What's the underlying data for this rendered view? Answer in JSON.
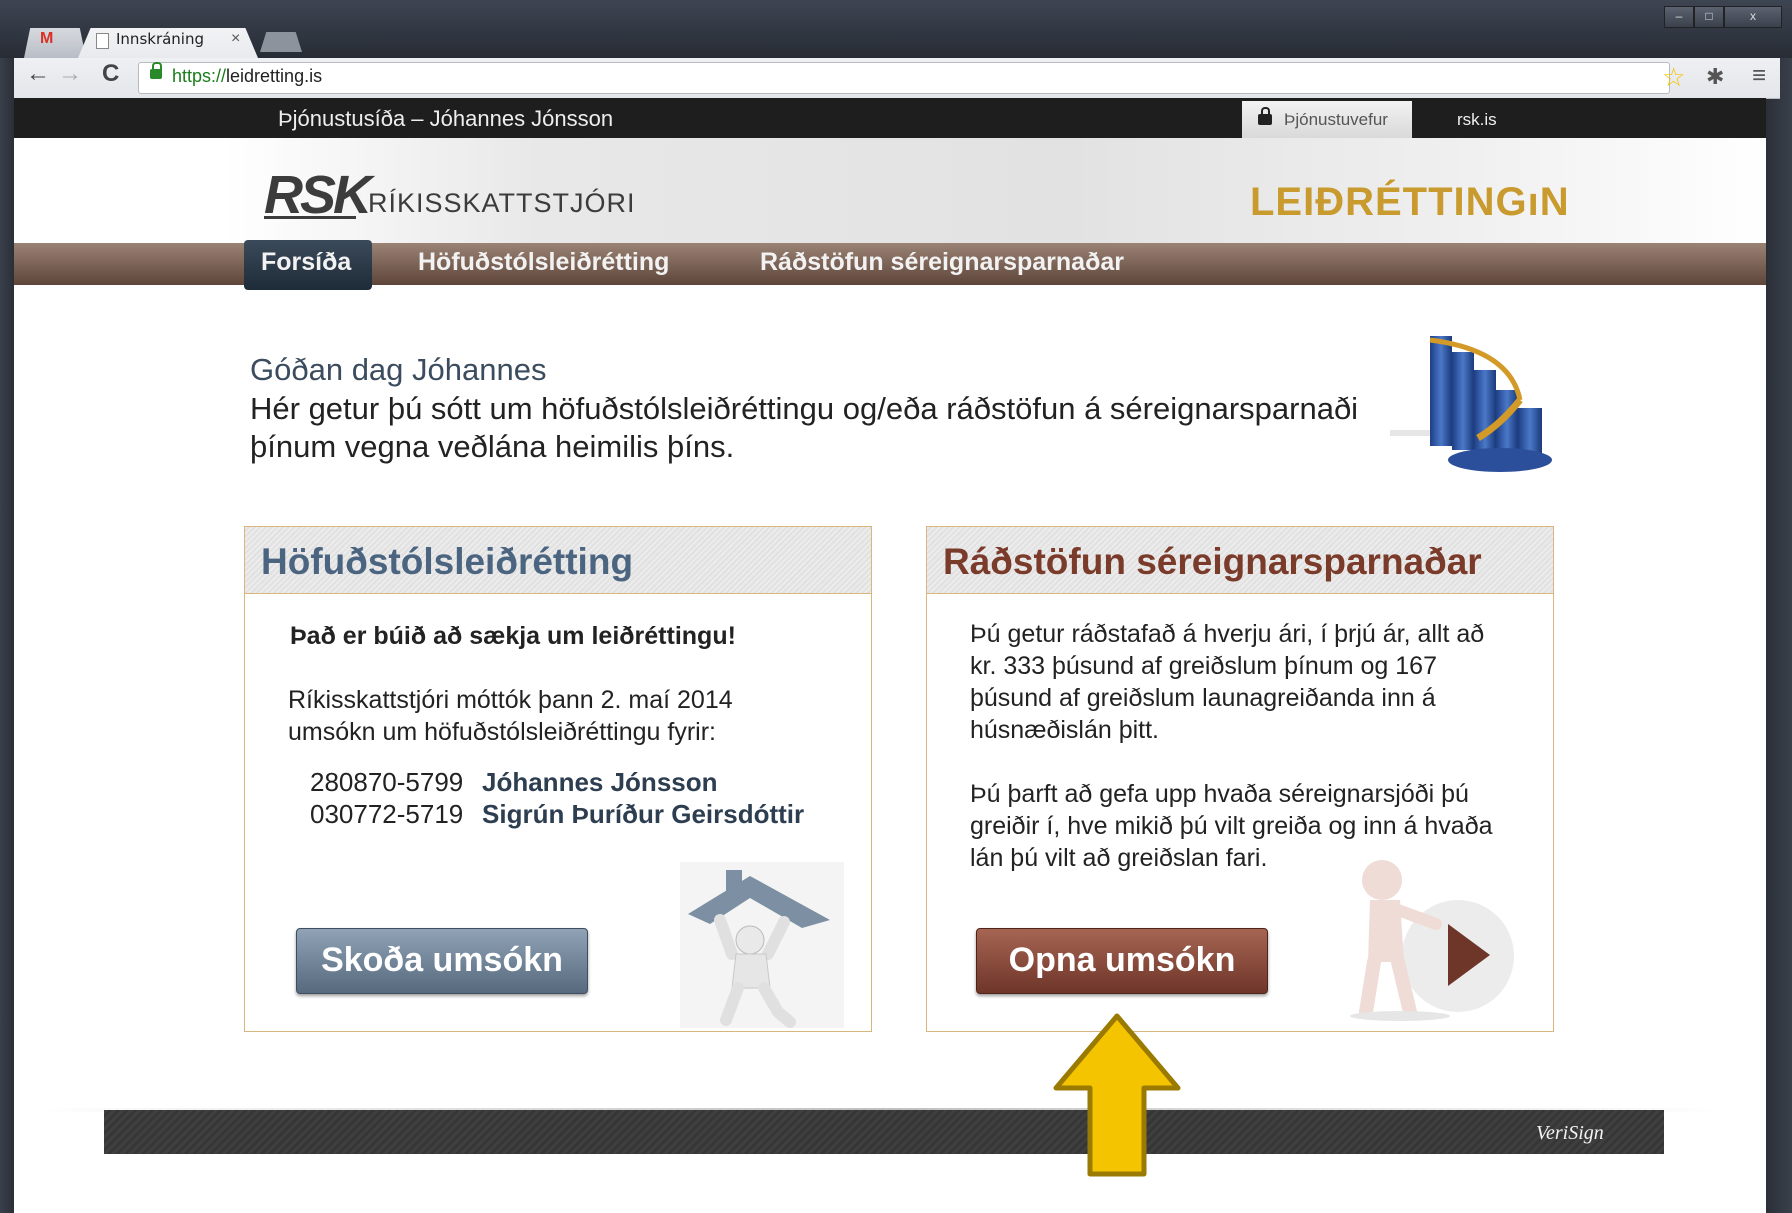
{
  "browser": {
    "tab_title": "Innskráning",
    "tab_close": "×",
    "url_scheme": "https://",
    "url_host": "leidretting.is",
    "window_buttons": [
      "–",
      "□",
      "x"
    ]
  },
  "topbar": {
    "title": "Þjónustusíða – Jóhannes Jónsson",
    "service_link": "Þjónustuvefur",
    "rsk_link": "rsk.is"
  },
  "header": {
    "logo_text": "RSK",
    "org_name": "RÍKISSKATTSTJÓRI",
    "brand": "LEIÐRÉTTINGıN"
  },
  "nav": {
    "items": [
      {
        "label": "Forsíða",
        "active": true
      },
      {
        "label": "Höfuðstólsleiðrétting"
      },
      {
        "label": "Ráðstöfun séreignarsparnaðar"
      }
    ]
  },
  "main": {
    "greeting": "Góðan dag Jóhannes",
    "intro": "Hér getur þú sótt um höfuðstólsleiðréttingu og/eða ráðstöfun á séreignarsparnaði þínum vegna veðlána heimilis þíns."
  },
  "card_principal": {
    "title": "Höfuðstólsleiðrétting",
    "status": "Það er búið að sækja um leiðréttingu!",
    "text": "Ríkisskattstjóri móttók þann 2. maí 2014 umsókn um höfuðstólsleiðréttingu fyrir:",
    "applicants": [
      {
        "id": "280870-5799",
        "name": "Jóhannes Jónsson"
      },
      {
        "id": "030772-5719",
        "name": "Sigrún Þuríður Geirsdóttir"
      }
    ],
    "button": "Skoða umsókn"
  },
  "card_pension": {
    "title": "Ráðstöfun séreignarsparnaðar",
    "paragraph1": "Þú getur ráðstafað á hverju ári, í þrjú ár, allt að kr. 333 þúsund af greiðslum þínum og 167 þúsund af greiðslum launagreiðanda inn á húsnæðislán þitt.",
    "paragraph2": "Þú þarft að gefa upp hvaða séreignarsjóði þú greiðir í, hve mikið þú vilt greiða og inn á hvaða lán þú vilt að greiðslan fari.",
    "button": "Opna umsókn"
  },
  "footer": {
    "verisign": "VeriSign"
  },
  "colors": {
    "accent_gold": "#c99a2e",
    "nav_brown": "#7a5e50",
    "principal_blue": "#4b6580",
    "pension_red": "#7a3b2b",
    "arrow_yellow": "#f5c400"
  }
}
